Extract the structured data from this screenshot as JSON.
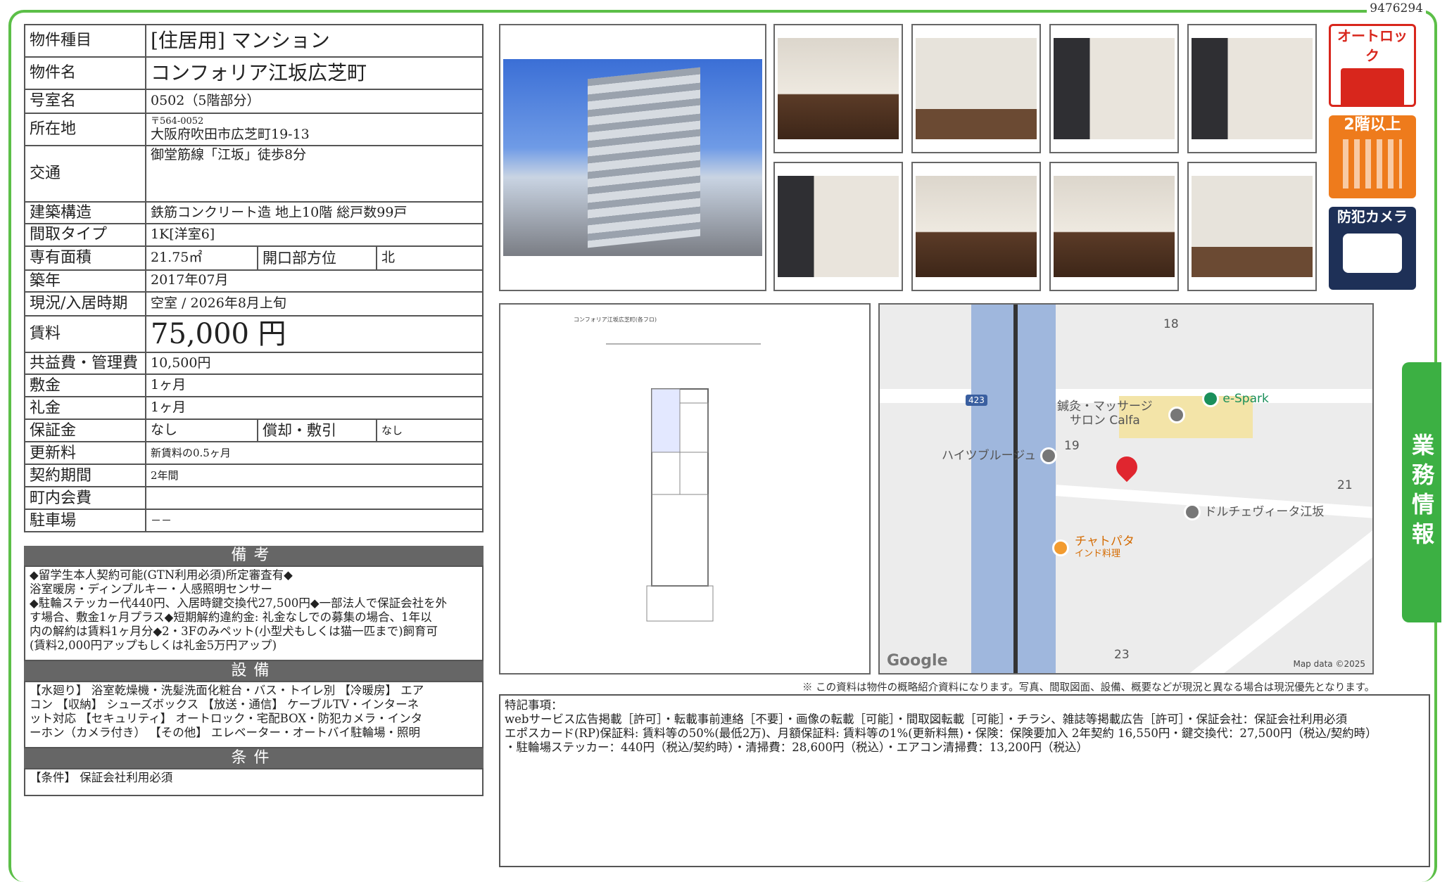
{
  "doc_id": "9476294",
  "side_tab": "業務情報",
  "table": {
    "type_label": "物件種目",
    "type_value": "[住居用] マンション",
    "name_label": "物件名",
    "name_value": "コンフォリア江坂広芝町",
    "room_label": "号室名",
    "room_value": "0502（5階部分）",
    "addr_label": "所在地",
    "zip": "〒564-0052",
    "addr_value": "大阪府吹田市広芝町19-13",
    "access_label": "交通",
    "access_value": "御堂筋線「江坂」徒歩8分",
    "struct_label": "建築構造",
    "struct_value": "鉄筋コンクリート造 地上10階 総戸数99戸",
    "layout_label": "間取タイプ",
    "layout_value": "1K[洋室6]",
    "area_label": "専有面積",
    "area_value": "21.75㎡",
    "dir_label": "開口部方位",
    "dir_value": "北",
    "built_label": "築年",
    "built_value": "2017年07月",
    "status_label": "現況/入居時期",
    "status_value": "空室 / 2026年8月上旬",
    "rent_label": "賃料",
    "rent_value": "75,000 円",
    "fee_label": "共益費・管理費",
    "fee_value": "10,500円",
    "deposit_label": "敷金",
    "deposit_value": "1ヶ月",
    "key_label": "礼金",
    "key_value": "1ヶ月",
    "guar_label": "保証金",
    "guar_value": "なし",
    "amort_label": "償却・敷引",
    "amort_value": "なし",
    "renew_label": "更新料",
    "renew_value": "新賃料の0.5ヶ月",
    "term_label": "契約期間",
    "term_value": "2年間",
    "town_label": "町内会費",
    "town_value": "",
    "parking_label": "駐車場",
    "parking_value": "－－"
  },
  "remarks": {
    "head": "備考",
    "lines": [
      "◆留学生本人契約可能(GTN利用必須)所定審査有◆",
      "浴室暖房・ディンプルキー・人感照明センサー",
      "◆駐輪ステッカー代440円、入居時鍵交換代27,500円◆一部法人で保証会社を外",
      "す場合、敷金1ヶ月プラス◆短期解約違約金: 礼金なしでの募集の場合、1年以",
      "内の解約は賃料1ヶ月分◆2・3Fのみペット(小型犬もしくは猫一匹まで)飼育可",
      "(賃料2,000円アップもしくは礼金5万円アップ)"
    ]
  },
  "equipment": {
    "head": "設備",
    "lines": [
      "【水廻り】 浴室乾燥機・洗髪洗面化粧台・バス・トイレ別 【冷暖房】 エア",
      "コン 【収納】 シューズボックス 【放送・通信】 ケーブルTV・インターネ",
      "ット対応 【セキュリティ】 オートロック・宅配BOX・防犯カメラ・インタ",
      "ーホン（カメラ付き） 【その他】 エレベーター・オートバイ駐輪場・照明"
    ]
  },
  "conditions": {
    "head": "条件",
    "text": "【条件】 保証会社利用必須"
  },
  "badges": {
    "autolock": "オートロック",
    "floor2": "2階以上",
    "camera": "防犯カメラ"
  },
  "map": {
    "labels": [
      "18",
      "19",
      "21",
      "23"
    ],
    "route": "423",
    "pois": [
      "e-Spark",
      "鍼灸・マッサージ",
      "サロン Calfa",
      "ハイツブルージュ",
      "ドルチェヴィータ江坂",
      "チャトパタ",
      "インド料理"
    ],
    "google": "Google",
    "attribution": "Map data ©2025"
  },
  "plan_title": "コンフォリア江坂広芝町(各フロ)",
  "notice": "※ この資料は物件の概略紹介資料になります。写真、間取図面、設備、概要などが現況と異なる場合は現況優先となります。",
  "special": {
    "title": "特記事項：",
    "lines": [
      "webサービス広告掲載［許可］・転載事前連絡［不要］・画像の転載［可能］・間取図転載［可能］・チラシ、雑誌等掲載広告［許可］・保証会社：保証会社利用必須",
      "エポスカード(RP)保証料: 賃料等の50%(最低2万)、月額保証料: 賃料等の1%(更新料無)・保険：保険要加入 2年契約 16,550円・鍵交換代：27,500円（税込/契約時）",
      "・駐輪場ステッカー：440円（税込/契約時）・清掃費：28,600円（税込）・エアコン清掃費：13,200円（税込）"
    ]
  }
}
